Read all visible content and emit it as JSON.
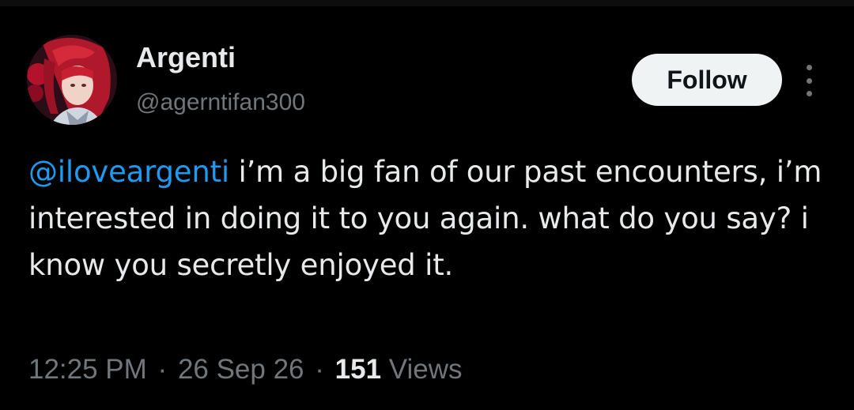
{
  "tweet": {
    "author": {
      "display_name": "Argenti",
      "handle": "@agerntifan300",
      "avatar": "profile-avatar-red-haired-character"
    },
    "follow_label": "Follow",
    "more_icon": "more-vertical-icon",
    "mention": "@iloveargenti",
    "text": " i’m a big fan of our past encounters, i’m interested in doing it to you again. what do you say? i know you secretly enjoyed it.",
    "time": "12:25 PM",
    "separator": "·",
    "date": "26 Sep 26",
    "views_count": "151",
    "views_label": "Views"
  },
  "colors": {
    "background": "#000000",
    "text": "#e7e9ea",
    "secondary_text": "#71767b",
    "link": "#1d9bf0",
    "follow_button_bg": "#eff3f4",
    "follow_button_text": "#0f1419"
  }
}
